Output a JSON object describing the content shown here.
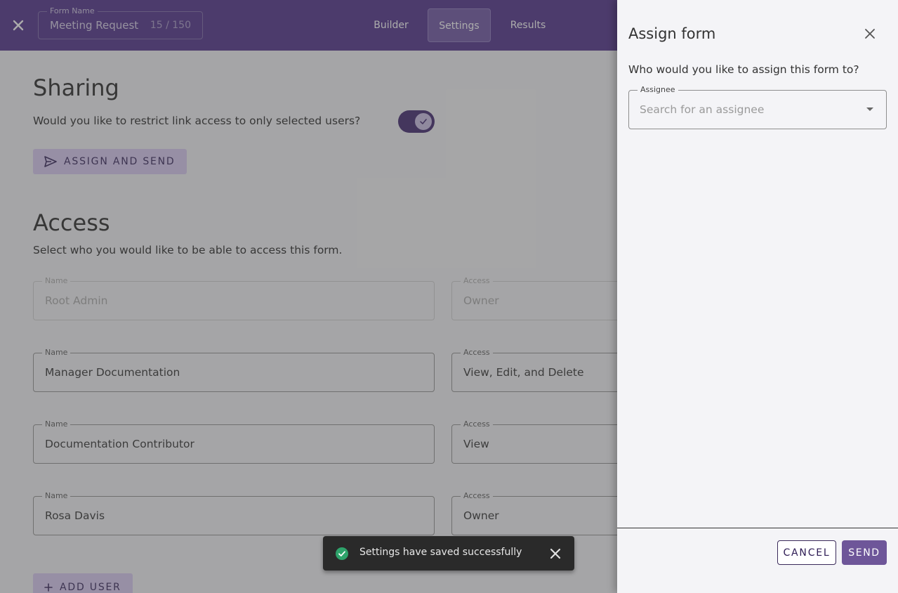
{
  "topbar": {
    "form_name_label": "Form Name",
    "form_name_value": "Meeting Request",
    "form_name_count": "15 / 150",
    "tabs": [
      {
        "label": "Builder"
      },
      {
        "label": "Settings"
      },
      {
        "label": "Results"
      }
    ],
    "active_tab": "Settings",
    "close_icon": "close-icon"
  },
  "sharing": {
    "title": "Sharing",
    "question": "Would you like to restrict link access to only selected users?",
    "toggle_on": true,
    "assign_send_label": "ASSIGN AND SEND"
  },
  "access": {
    "title": "Access",
    "description": "Select who you would like to be able to access this form.",
    "name_label": "Name",
    "access_label": "Access",
    "rows": [
      {
        "name": "Root Admin",
        "access": "Owner",
        "disabled": true
      },
      {
        "name": "Manager Documentation",
        "access": "View, Edit, and Delete",
        "disabled": false
      },
      {
        "name": "Documentation Contributor",
        "access": "View",
        "disabled": false
      },
      {
        "name": "Rosa Davis",
        "access": "Owner",
        "disabled": false
      }
    ],
    "add_user_label": "ADD USER"
  },
  "snackbar": {
    "message": "Settings have saved successfully"
  },
  "drawer": {
    "title": "Assign form",
    "question": "Who would you like to assign this form to?",
    "assignee_label": "Assignee",
    "assignee_placeholder": "Search for an assignee",
    "cancel_label": "CANCEL",
    "send_label": "SEND"
  },
  "colors": {
    "brand": "#4a2a86",
    "accent": "#6e5699",
    "tinted_button": "#d9c9f4",
    "success": "#2ea36b"
  }
}
